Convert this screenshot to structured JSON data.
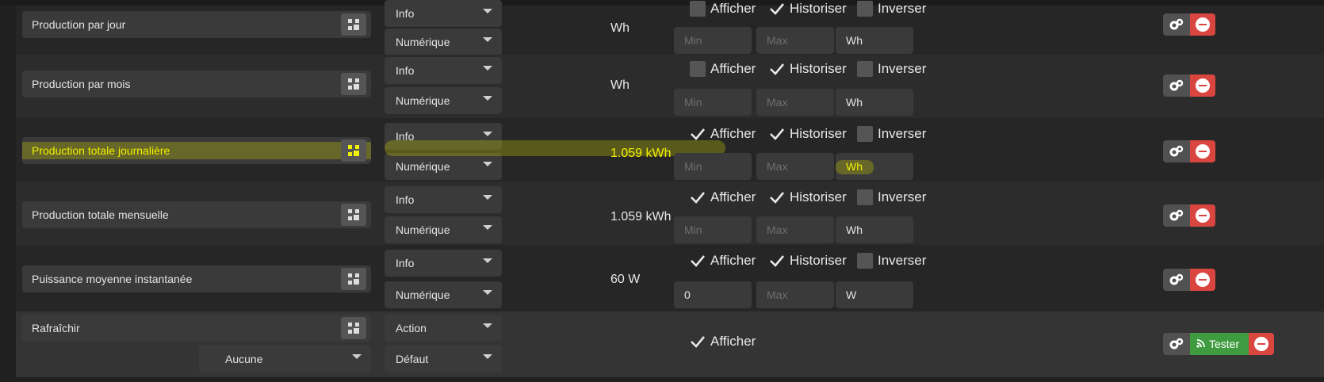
{
  "rows": [
    {
      "name": "Production par jour",
      "type": "Info",
      "subtype": "Numérique",
      "value": "Wh",
      "afficher": {
        "label": "Afficher",
        "checked": false
      },
      "historiser": {
        "label": "Historiser",
        "checked": true
      },
      "inverser": {
        "label": "Inverser",
        "checked": false
      },
      "min": {
        "value": "",
        "placeholder": "Min"
      },
      "max": {
        "value": "",
        "placeholder": "Max"
      },
      "unit": {
        "value": "Wh"
      }
    },
    {
      "name": "Production par mois",
      "type": "Info",
      "subtype": "Numérique",
      "value": "Wh",
      "afficher": {
        "label": "Afficher",
        "checked": false
      },
      "historiser": {
        "label": "Historiser",
        "checked": true
      },
      "inverser": {
        "label": "Inverser",
        "checked": false
      },
      "min": {
        "value": "",
        "placeholder": "Min"
      },
      "max": {
        "value": "",
        "placeholder": "Max"
      },
      "unit": {
        "value": "Wh"
      }
    },
    {
      "name": "Production totale journalière",
      "type": "Info",
      "subtype": "Numérique",
      "value": "1.059 kWh",
      "afficher": {
        "label": "Afficher",
        "checked": true
      },
      "historiser": {
        "label": "Historiser",
        "checked": true
      },
      "inverser": {
        "label": "Inverser",
        "checked": false
      },
      "min": {
        "value": "",
        "placeholder": "Min"
      },
      "max": {
        "value": "",
        "placeholder": "Max"
      },
      "unit": {
        "value": "Wh"
      }
    },
    {
      "name": "Production totale mensuelle",
      "type": "Info",
      "subtype": "Numérique",
      "value": "1.059 kWh",
      "afficher": {
        "label": "Afficher",
        "checked": true
      },
      "historiser": {
        "label": "Historiser",
        "checked": true
      },
      "inverser": {
        "label": "Inverser",
        "checked": false
      },
      "min": {
        "value": "",
        "placeholder": "Min"
      },
      "max": {
        "value": "",
        "placeholder": "Max"
      },
      "unit": {
        "value": "Wh"
      }
    },
    {
      "name": "Puissance moyenne instantanée",
      "type": "Info",
      "subtype": "Numérique",
      "value": "60 W",
      "afficher": {
        "label": "Afficher",
        "checked": true
      },
      "historiser": {
        "label": "Historiser",
        "checked": true
      },
      "inverser": {
        "label": "Inverser",
        "checked": false
      },
      "min": {
        "value": "0",
        "placeholder": "Min"
      },
      "max": {
        "value": "",
        "placeholder": "Max"
      },
      "unit": {
        "value": "W"
      }
    }
  ],
  "action_row": {
    "name": "Rafraîchir",
    "value_select": "Aucune",
    "type": "Action",
    "subtype": "Défaut",
    "afficher": {
      "label": "Afficher",
      "checked": true
    },
    "test_label": "Tester"
  },
  "icons": {
    "configure": "gears-icon",
    "remove": "minus-circle-icon",
    "test": "rss-icon",
    "name_picker": "puzzle-icon"
  },
  "colors": {
    "remove_button": "#d9453f",
    "test_button": "#3f9b3f",
    "highlight": "#e8e800"
  }
}
